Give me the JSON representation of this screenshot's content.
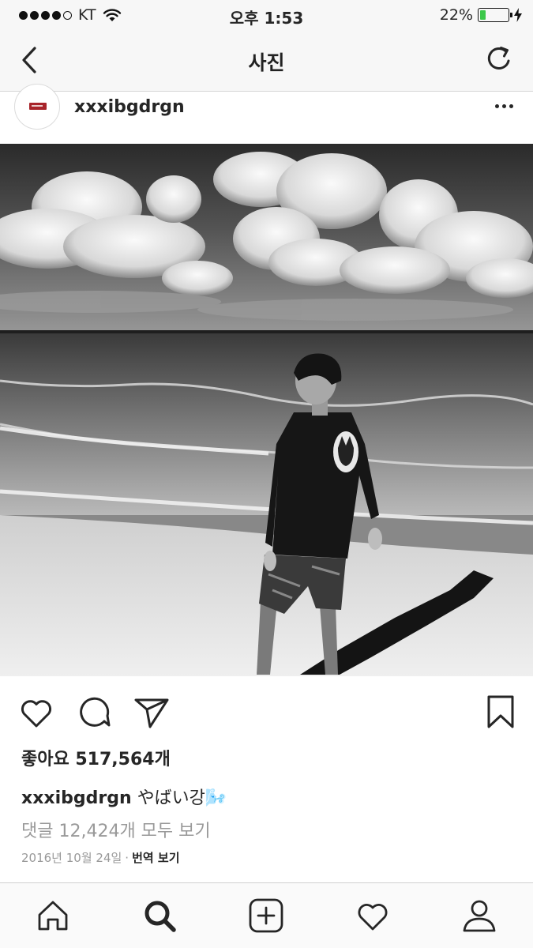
{
  "status_bar": {
    "carrier": "KT",
    "time": "오후 1:53",
    "battery_percent_label": "22%",
    "battery_level": 0.22
  },
  "nav": {
    "title": "사진",
    "back_icon": "chevron-left-icon",
    "refresh_icon": "refresh-icon"
  },
  "post": {
    "username": "xxxibgdrgn",
    "more_icon": "more-dots-icon",
    "photo_subject": "",
    "likes_label": "좋아요 517,564개",
    "caption": {
      "username": "xxxibgdrgn",
      "text": "やばい강🌬️"
    },
    "comments_label": "댓글 12,424개 모두 보기",
    "date": "2016년 10월 24일",
    "separator": "·",
    "translate_label": "번역 보기"
  },
  "actions": {
    "like_icon": "heart-icon",
    "comment_icon": "comment-icon",
    "share_icon": "send-icon",
    "save_icon": "bookmark-icon"
  },
  "tab_bar": {
    "items": [
      "home-icon",
      "search-icon",
      "add-post-icon",
      "activity-heart-icon",
      "profile-icon"
    ],
    "active": "search-icon"
  },
  "colors": {
    "bar_background": "#f7f7f7",
    "text": "#262626",
    "muted_text": "#999999",
    "battery_green": "#3cc84a"
  }
}
